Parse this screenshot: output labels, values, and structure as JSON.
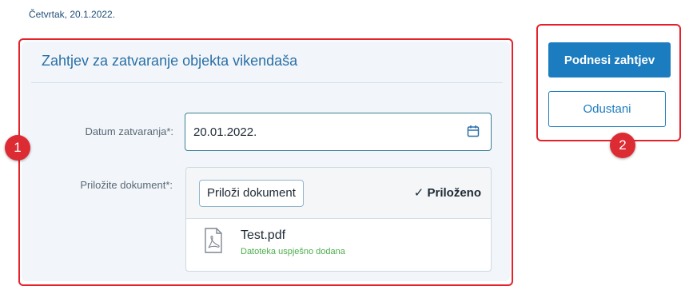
{
  "header": {
    "date": "Četvrtak, 20.1.2022."
  },
  "form": {
    "title": "Zahtjev za zatvaranje objekta vikendaša",
    "closing_date_label": "Datum zatvaranja*:",
    "closing_date_value": "20.01.2022.",
    "document_label": "Priložite dokument*:",
    "attach_button": "Priloži dokument",
    "attached_status": "✓ Priloženo",
    "file": {
      "name": "Test.pdf",
      "status": "Datoteka uspješno dodana"
    }
  },
  "actions": {
    "submit": "Podnesi zahtjev",
    "cancel": "Odustani"
  },
  "annotations": {
    "marker_1": "1",
    "marker_2": "2"
  },
  "colors": {
    "primary": "#1b7cbf",
    "highlight": "#e3222c",
    "success": "#4cae4c"
  },
  "icons": {
    "date_field": "calendar-icon",
    "file": "pdf-file-icon"
  }
}
